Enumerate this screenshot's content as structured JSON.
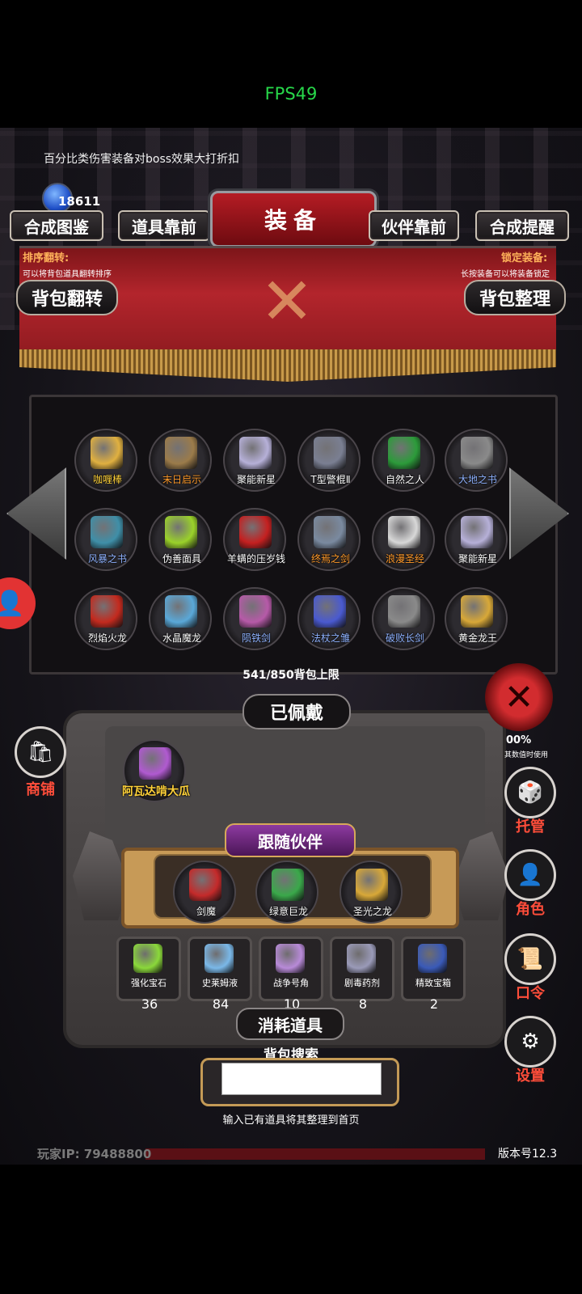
{
  "status": {
    "fps": "FPS49"
  },
  "notice": "百分比类伤害装备对boss效果大打折扣",
  "currency": {
    "amount": "18611"
  },
  "header": {
    "title": "装备",
    "tabs": [
      "合成图鉴",
      "道具靠前",
      "伙伴靠前",
      "合成提醒"
    ]
  },
  "banner": {
    "sort_title": "排序翻转:",
    "sort_note": "可以将背包道具翻转排序",
    "lock_title": "锁定装备:",
    "lock_note": "长按装备可以将装备锁定",
    "flip_button": "背包翻转",
    "arrange_button": "背包整理"
  },
  "inventory": {
    "items": [
      {
        "name": "咖喱棒",
        "color": "#e0b040",
        "label_color": "#ffd23a"
      },
      {
        "name": "末日启示",
        "color": "#9b7b4a",
        "label_color": "#ff9a2a"
      },
      {
        "name": "聚能新星",
        "color": "#b6b0d8",
        "label_color": "#ffffff"
      },
      {
        "name": "T型警棍Ⅱ",
        "color": "#7a7f92",
        "label_color": "#ffffff"
      },
      {
        "name": "自然之人",
        "color": "#2c9b3a",
        "label_color": "#ffffff"
      },
      {
        "name": "大地之书",
        "color": "#8a8a8a",
        "label_color": "#8fb2ff"
      },
      {
        "name": "风暴之书",
        "color": "#3f8fa8",
        "label_color": "#8fb2ff"
      },
      {
        "name": "伪善面具",
        "color": "#9ad12a",
        "label_color": "#ffffff"
      },
      {
        "name": "羊螨的压岁钱",
        "color": "#c42020",
        "label_color": "#ffffff"
      },
      {
        "name": "终焉之剑",
        "color": "#7a8aa0",
        "label_color": "#ff9a2a"
      },
      {
        "name": "浪漫圣经",
        "color": "#d8d8d8",
        "label_color": "#ff9a2a"
      },
      {
        "name": "聚能新星",
        "color": "#b6b0d8",
        "label_color": "#ffffff"
      },
      {
        "name": "烈焰火龙",
        "color": "#c32a1e",
        "label_color": "#ffffff"
      },
      {
        "name": "水晶魔龙",
        "color": "#5aa8d8",
        "label_color": "#ffffff"
      },
      {
        "name": "陨铁剑",
        "color": "#b65aa8",
        "label_color": "#8fb2ff"
      },
      {
        "name": "法杖之雏",
        "color": "#4a5ad0",
        "label_color": "#8fb2ff"
      },
      {
        "name": "破败长剑",
        "color": "#8a8a8a",
        "label_color": "#8fb2ff"
      },
      {
        "name": "黄金龙王",
        "color": "#d8a838",
        "label_color": "#ffffff"
      }
    ],
    "capacity": "541/850背包上限"
  },
  "equipped": {
    "title": "已佩戴",
    "item": {
      "name": "阿瓦达啃大瓜",
      "color": "#b05ad0",
      "label_color": "#ffd23a"
    }
  },
  "followers": {
    "title": "跟随伙伴",
    "list": [
      {
        "name": "剑魔",
        "color": "#c42a2a"
      },
      {
        "name": "绿意巨龙",
        "color": "#3aa84a"
      },
      {
        "name": "圣光之龙",
        "color": "#d8a838"
      }
    ]
  },
  "consumables": {
    "title": "消耗道具",
    "list": [
      {
        "name": "强化宝石",
        "count": "36",
        "color": "#8ad83a"
      },
      {
        "name": "史莱姆液",
        "count": "84",
        "color": "#7ab8e8"
      },
      {
        "name": "战争号角",
        "count": "10",
        "color": "#b88ad8"
      },
      {
        "name": "剧毒药剂",
        "count": "8",
        "color": "#9a9ab8"
      },
      {
        "name": "精致宝箱",
        "count": "2",
        "color": "#3a5ab8"
      }
    ]
  },
  "search": {
    "label": "背包搜索",
    "value": "",
    "hint": "输入已有道具将其整理到首页"
  },
  "side_menu": {
    "shop": "商铺",
    "pct": "00%",
    "pct_note": "其数值时使用",
    "manage": "托管",
    "role": "角色",
    "password": "口令",
    "settings": "设置"
  },
  "footer": {
    "player_ip": "玩家IP: 79488800",
    "version": "版本号12.3"
  }
}
